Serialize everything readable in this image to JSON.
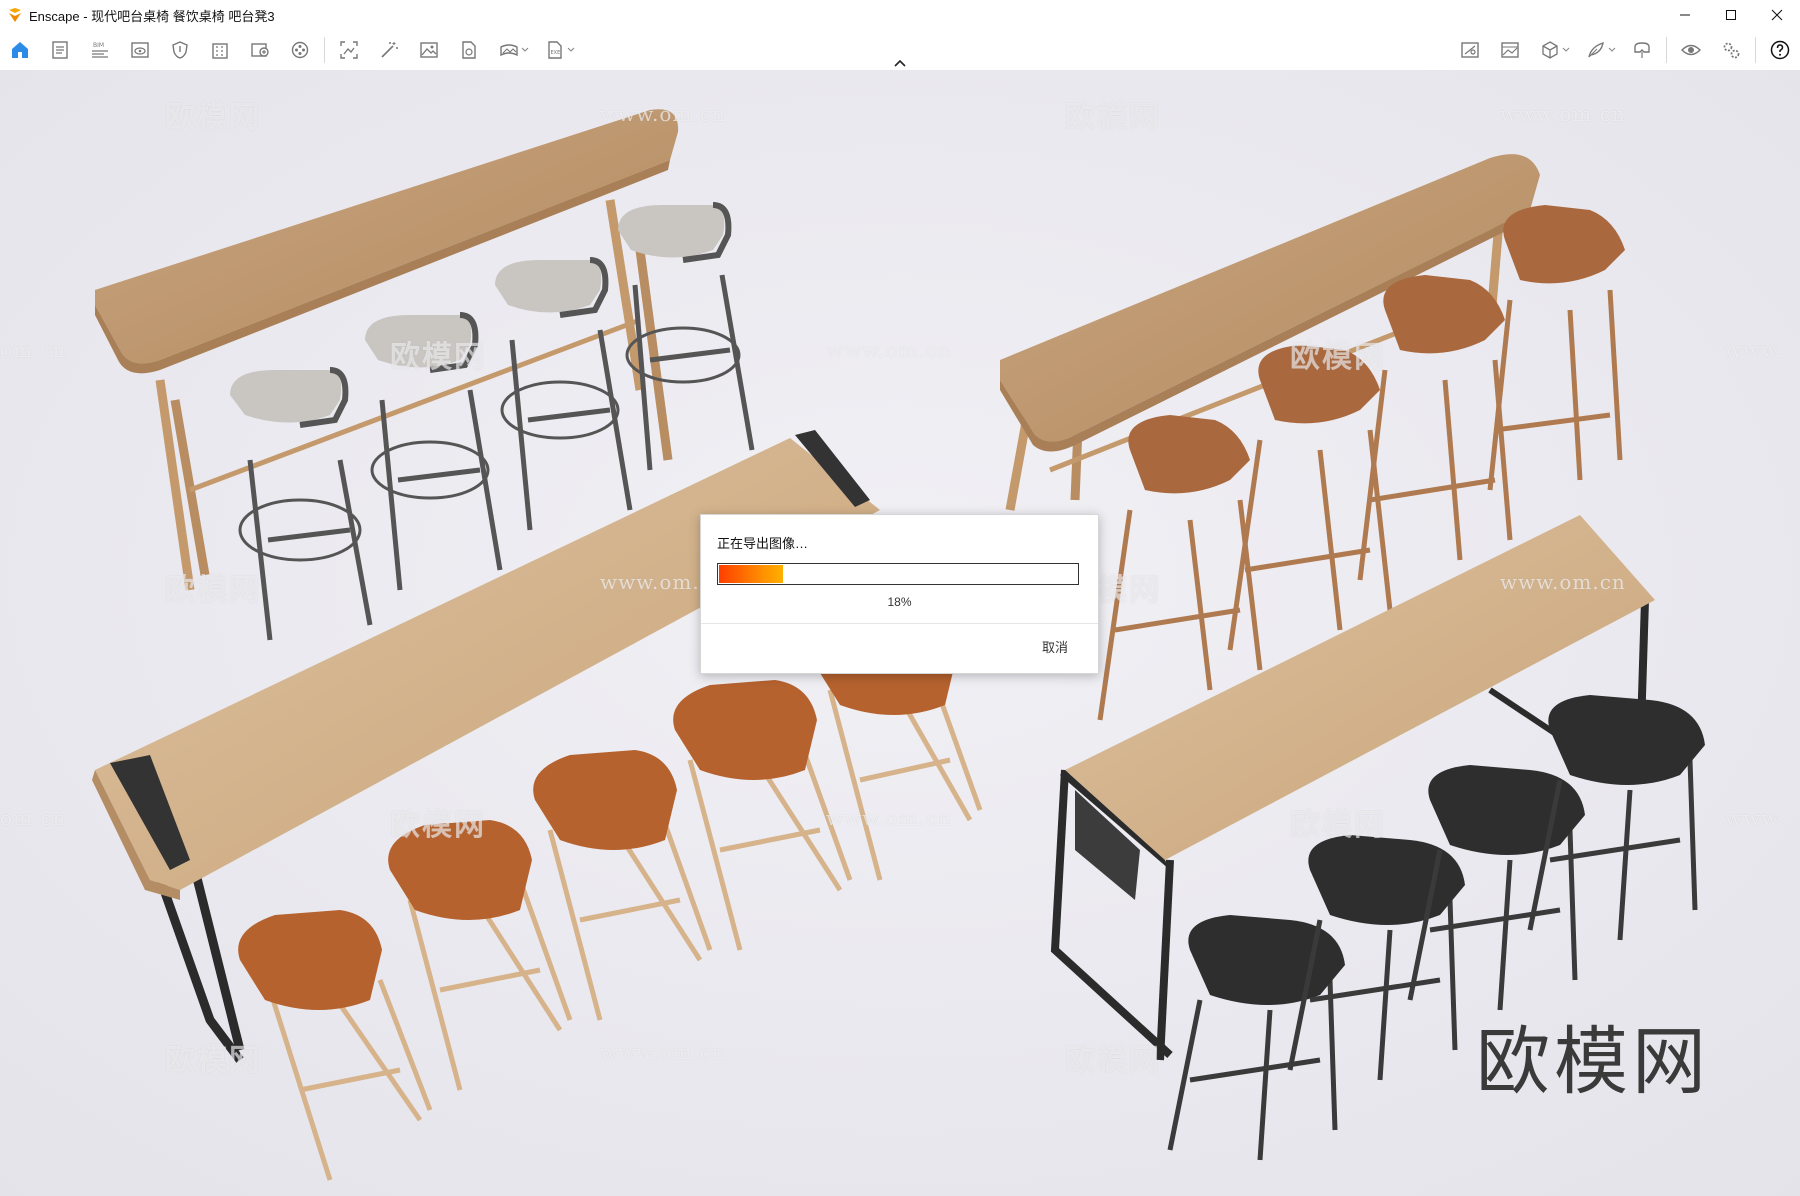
{
  "window": {
    "title": "Enscape - 现代吧台桌椅 餐饮桌椅 吧台凳3",
    "controls": [
      "minimize-icon",
      "maximize-icon",
      "close-icon"
    ]
  },
  "toolbar": {
    "left_icons": [
      "home-icon",
      "document-icon",
      "bim-icon",
      "view-icon",
      "shield-icon",
      "building-icon",
      "asset-library-icon",
      "video-reel-icon"
    ],
    "middle_icons": [
      "screenshot-icon",
      "magic-wand-icon",
      "image-icon",
      "export-file-icon",
      "panorama-icon",
      "exe-export-icon"
    ],
    "right_icons": [
      "views-map-icon",
      "image-gallery-icon",
      "cube-icon",
      "feather-icon",
      "vr-headset-icon",
      "eye-icon",
      "settings-icon",
      "help-icon"
    ],
    "accent_color": "#2b8be6"
  },
  "watermarks": {
    "logo_text": "欧模网",
    "url_text": "www.om.cn",
    "url_partial": "om.cn",
    "url_partial_right": "www."
  },
  "brand_mark": "欧模网",
  "dialog": {
    "title": "正在导出图像…",
    "progress_value": 18,
    "progress_text": "18%",
    "cancel_label": "取消",
    "progress_colors": [
      "#ff3e00",
      "#ffb000"
    ]
  }
}
